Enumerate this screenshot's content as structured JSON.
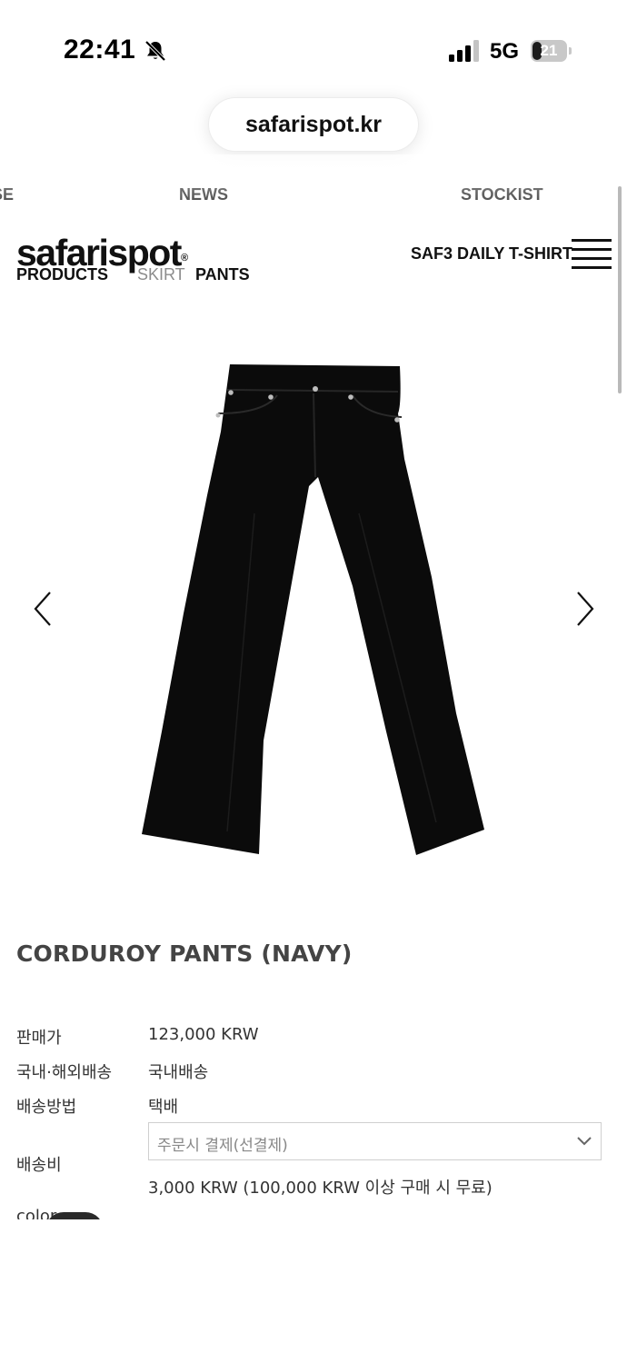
{
  "status_bar": {
    "time": "22:41",
    "network": "5G",
    "battery": "21"
  },
  "browser": {
    "url": "safarispot.kr"
  },
  "top_nav": {
    "items": [
      "SE",
      "NEWS",
      "STOCKIST"
    ]
  },
  "header": {
    "logo": "safarispot",
    "logo_mark": "®",
    "categories": [
      "PRODUCTS",
      "SKIRT",
      "PANTS"
    ],
    "promo": "SAF3 DAILY T-SHIRT"
  },
  "product": {
    "title": "CORDUROY PANTS (NAVY)",
    "details": [
      {
        "label": "판매가",
        "value": "123,000 KRW"
      },
      {
        "label": "국내·해외배송",
        "value": "국내배송"
      },
      {
        "label": "배송방법",
        "value": "택배"
      },
      {
        "label": "배송비",
        "select": "주문시 결제(선결제)",
        "value": "3,000 KRW (100,000 KRW 이상 구매 시 무료)"
      }
    ],
    "color_label": "color"
  }
}
